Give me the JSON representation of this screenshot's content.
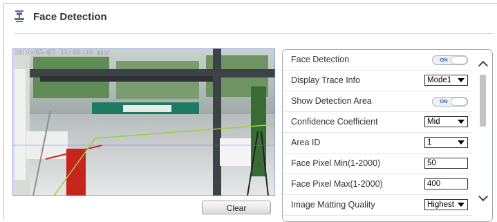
{
  "header": {
    "title": "Face Detection",
    "icon": "face-detection-icon"
  },
  "video": {
    "osd_text": "2019-05-07 11:48:18 mmr"
  },
  "clear_button": {
    "label": "Clear"
  },
  "settings": {
    "face_detection": {
      "label": "Face Detection",
      "state": "ON"
    },
    "display_trace_info": {
      "label": "Display Trace Info",
      "value": "Mode1"
    },
    "show_detection_area": {
      "label": "Show Detection Area",
      "state": "ON"
    },
    "confidence_coefficient": {
      "label": "Confidence Coefficient",
      "value": "Mid"
    },
    "area_id": {
      "label": "Area ID",
      "value": "1"
    },
    "face_pixel_min": {
      "label": "Face Pixel Min(1-2000)",
      "value": "50"
    },
    "face_pixel_max": {
      "label": "Face Pixel Max(1-2000)",
      "value": "400"
    },
    "image_matting_quality": {
      "label": "Image Matting Quality",
      "value": "Highest"
    }
  },
  "colors": {
    "toggle_on": "#2a63c7",
    "panel_border": "#9ea8b8"
  }
}
